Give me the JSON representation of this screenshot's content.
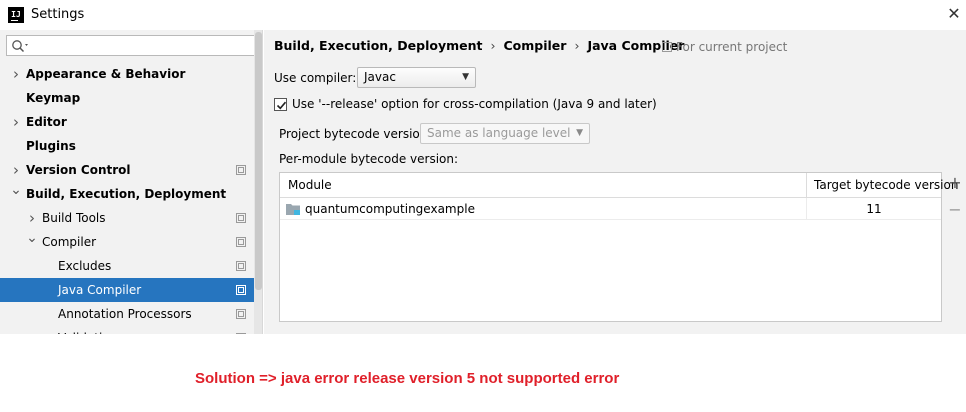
{
  "window": {
    "app_icon_text": "IJ",
    "title": "Settings",
    "close_glyph": "✕"
  },
  "sidebar": {
    "search": {
      "value": "",
      "placeholder": ""
    },
    "items": [
      {
        "label": "Appearance & Behavior",
        "level": 0,
        "bold": true,
        "arrow": "right",
        "project_icon": false
      },
      {
        "label": "Keymap",
        "level": 0,
        "bold": true,
        "arrow": "none",
        "project_icon": false
      },
      {
        "label": "Editor",
        "level": 0,
        "bold": true,
        "arrow": "right",
        "project_icon": false
      },
      {
        "label": "Plugins",
        "level": 0,
        "bold": true,
        "arrow": "none",
        "project_icon": false
      },
      {
        "label": "Version Control",
        "level": 0,
        "bold": true,
        "arrow": "right",
        "project_icon": true
      },
      {
        "label": "Build, Execution, Deployment",
        "level": 0,
        "bold": true,
        "arrow": "down",
        "project_icon": false
      },
      {
        "label": "Build Tools",
        "level": 1,
        "bold": false,
        "arrow": "right",
        "project_icon": true
      },
      {
        "label": "Compiler",
        "level": 1,
        "bold": false,
        "arrow": "down",
        "project_icon": true
      },
      {
        "label": "Excludes",
        "level": 2,
        "bold": false,
        "arrow": "none",
        "project_icon": true
      },
      {
        "label": "Java Compiler",
        "level": 2,
        "bold": false,
        "arrow": "none",
        "project_icon": true,
        "selected": true
      },
      {
        "label": "Annotation Processors",
        "level": 2,
        "bold": false,
        "arrow": "none",
        "project_icon": true
      },
      {
        "label": "Validation",
        "level": 2,
        "bold": false,
        "arrow": "none",
        "project_icon": true,
        "partial": true
      }
    ]
  },
  "main": {
    "breadcrumb": [
      "Build, Execution, Deployment",
      "Compiler",
      "Java Compiler"
    ],
    "breadcrumb_sep": "›",
    "scope_label": "For current project",
    "use_compiler": {
      "label": "Use compiler:",
      "value": "Javac"
    },
    "release_option": {
      "label": "Use '--release' option for cross-compilation (Java 9 and later)",
      "checked": true
    },
    "project_bytecode": {
      "label": "Project bytecode version:",
      "value": "Same as language level"
    },
    "per_module_label": "Per-module bytecode version:",
    "table": {
      "columns": [
        "Module",
        "Target bytecode version"
      ],
      "rows": [
        {
          "module": "quantumcomputingexample",
          "target": "11"
        }
      ]
    },
    "add_glyph": "+",
    "remove_glyph": "−"
  },
  "caption": "Solution => java error release version 5 not supported error",
  "colors": {
    "selection": "#2675bf",
    "caption": "#e0202a",
    "panel_bg": "#f2f2f2"
  }
}
